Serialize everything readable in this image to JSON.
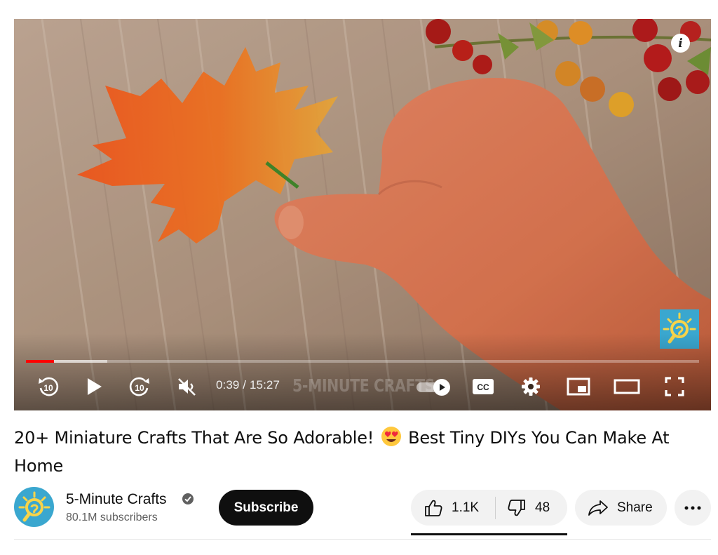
{
  "player": {
    "current_time": "0:39",
    "duration": "15:27",
    "time_display": "0:39 / 15:27",
    "brand_overlay": "5-MINUTE CRAFTS",
    "progress_played_fraction": 0.042,
    "progress_buffered_fraction": 0.121,
    "autoplay_on": true,
    "muted": true,
    "icons": [
      "rewind-10-icon",
      "play-icon",
      "forward-10-icon",
      "volume-muted-icon",
      "autoplay-toggle",
      "captions-icon",
      "settings-gear-icon",
      "miniplayer-icon",
      "theater-mode-icon",
      "fullscreen-icon",
      "info-icon"
    ],
    "info_label": "i",
    "colors": {
      "progress": "#ff0000",
      "controls": "#ffffff"
    }
  },
  "video": {
    "title_part1": "20+ Miniature Crafts That Are So Adorable!",
    "title_part2": "Best Tiny DIYs You Can Make At Home",
    "emoji": "heart-eyes-emoji"
  },
  "channel": {
    "name": "5-Minute Crafts",
    "verified": true,
    "subscribers": "80.1M subscribers",
    "subscribe_label": "Subscribe"
  },
  "actions": {
    "likes": "1.1K",
    "dislikes": "48",
    "share_label": "Share",
    "more_icon": "more-horizontal-icon"
  }
}
